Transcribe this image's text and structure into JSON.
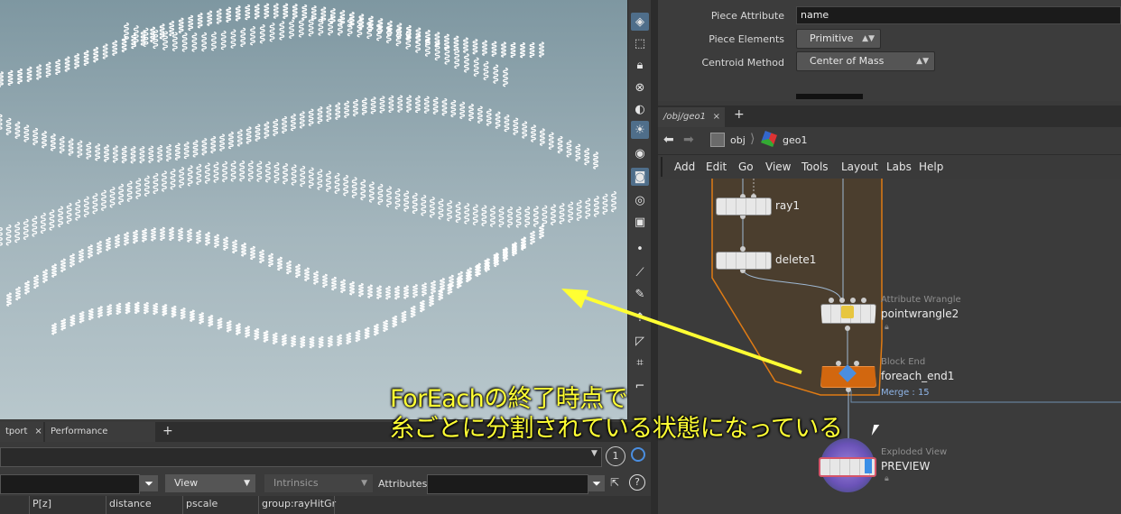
{
  "params": {
    "piece_attribute_label": "Piece Attribute",
    "piece_attribute_value": "name",
    "piece_elements_label": "Piece Elements",
    "piece_elements_value": "Primitive",
    "centroid_method_label": "Centroid Method",
    "centroid_method_value": "Center of Mass"
  },
  "network": {
    "tab_label": "/obj/geo1",
    "path": [
      "obj",
      "geo1"
    ],
    "menu": [
      "Add",
      "Edit",
      "Go",
      "View",
      "Tools",
      "Layout",
      "Labs",
      "Help"
    ],
    "nodes": {
      "ray": {
        "name": "ray1"
      },
      "delete": {
        "name": "delete1"
      },
      "wrangle": {
        "type": "Attribute Wrangle",
        "name": "pointwrangle2"
      },
      "foreach_end": {
        "type": "Block End",
        "name": "foreach_end1",
        "badge": "Merge : 15"
      },
      "preview": {
        "type": "Exploded View",
        "name": "PREVIEW"
      }
    }
  },
  "spreadsheet": {
    "tabs": [
      "tport",
      "Performance Monitor"
    ],
    "view_label": "View",
    "intrinsics_label": "Intrinsics",
    "attributes_label": "Attributes:",
    "page_number": "1",
    "columns": [
      "P[z]",
      "distance",
      "pscale",
      "group:rayHitGr"
    ]
  },
  "annotation": {
    "line1": "ForEachの終了時点で",
    "line2": "糸ごとに分割されている状態になっている"
  },
  "colors": {
    "annotation": "#ffff33",
    "foreach_subnet": "#e07b14",
    "selection": "#4f6e8a"
  }
}
